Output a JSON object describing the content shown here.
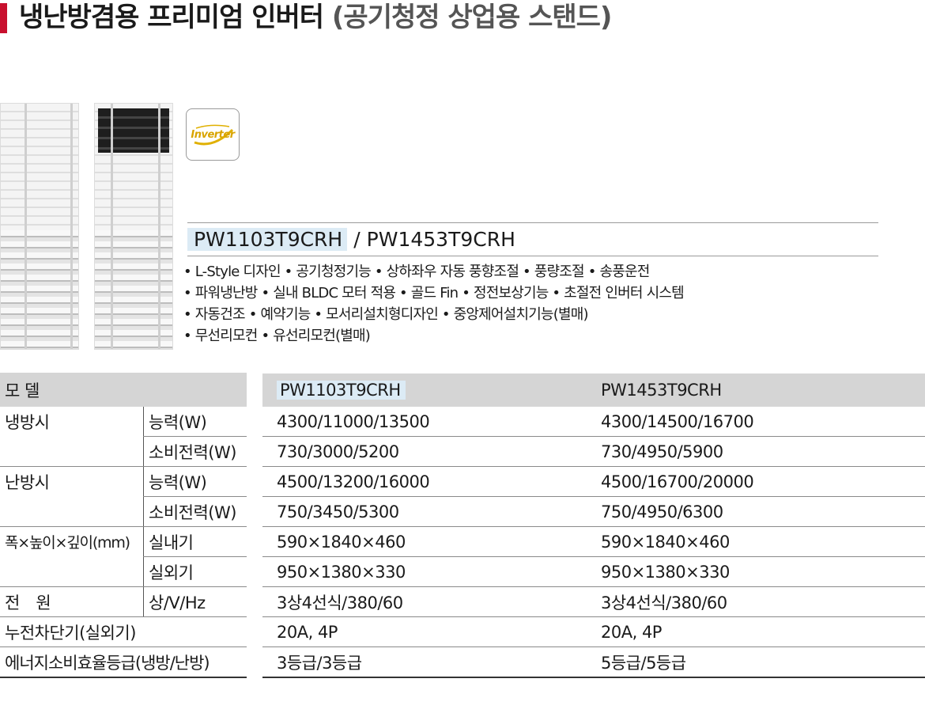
{
  "title": {
    "main": "냉난방겸용 프리미엄 인버터",
    "sub": "(공기청정 상업용 스탠드)"
  },
  "badge": {
    "text": "Inverter"
  },
  "models": {
    "model1": "PW1103T9CRH",
    "separator": "/",
    "model2": "PW1453T9CRH"
  },
  "features": [
    "• L-Style 디자인 • 공기청정기능 • 상하좌우 자동 풍향조절 • 풍량조절 • 송풍운전",
    "• 파워냉난방 • 실내 BLDC 모터 적용 • 골드 Fin • 정전보상기능 • 초절전 인버터 시스템",
    "• 자동건조 • 예약기능 • 모서리설치형디자인 • 중앙제어설치기능(별매)",
    "• 무선리모컨 • 유선리모컨(별매)"
  ],
  "spec": {
    "header": {
      "label": "모 델",
      "model1": "PW1103T9CRH",
      "model2": "PW1453T9CRH"
    },
    "rows": [
      {
        "group": "냉방시",
        "item": "능력(W)",
        "v1": "4300/11000/13500",
        "v2": "4300/14500/16700"
      },
      {
        "group": "",
        "item": "소비전력(W)",
        "v1": "730/3000/5200",
        "v2": "730/4950/5900"
      },
      {
        "group": "난방시",
        "item": "능력(W)",
        "v1": "4500/13200/16000",
        "v2": "4500/16700/20000"
      },
      {
        "group": "",
        "item": "소비전력(W)",
        "v1": "750/3450/5300",
        "v2": "750/4950/6300"
      },
      {
        "group": "폭×높이×깊이(mm)",
        "item": "실내기",
        "v1": "590×1840×460",
        "v2": "590×1840×460"
      },
      {
        "group": "",
        "item": "실외기",
        "v1": "950×1380×330",
        "v2": "950×1380×330"
      },
      {
        "group": "전　원",
        "item": "상/V/Hz",
        "v1": "3상4선식/380/60",
        "v2": "3상4선식/380/60"
      },
      {
        "group": "누전차단기(실외기)",
        "item": "",
        "v1": "20A, 4P",
        "v2": "20A, 4P"
      },
      {
        "group": "에너지소비효율등급(냉방/난방)",
        "item": "",
        "v1": "3등급/3등급",
        "v2": "5등급/5등급"
      }
    ]
  }
}
